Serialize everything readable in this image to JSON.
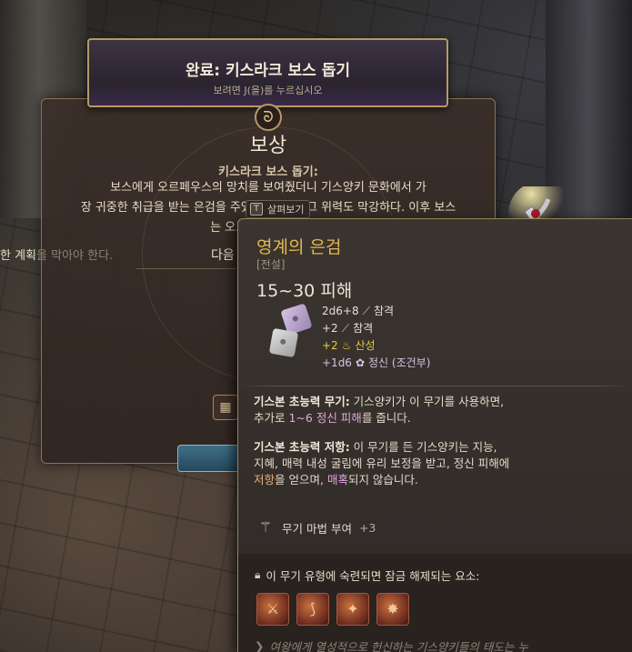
{
  "quest": {
    "banner_title": "완료: 키스라크 보스 돕기",
    "banner_subtitle": "보려면 J(을)를 누르십시오",
    "reward_title": "보상",
    "quest_name": "키스라크 보스 돕기:",
    "description_lines": [
      "보스에게 오르페우스의 망치를 보여줬더니 기스양키 문화에서 가",
      "장 귀중한 취급을 받는 은검을 주었다. 하지만 그 위력도 막강하다. 이후 보스",
      "는 오르페우스를 구출한"
    ],
    "description_cut": "한 계획",
    "description_faded": "을 막아야 한다.",
    "next_label": "다음"
  },
  "inspect_hint": {
    "key": "T",
    "label": "살펴보기"
  },
  "item": {
    "name": "영계의 은검",
    "rarity": "[전설]",
    "damage": "15~30 피해",
    "damage_lines": [
      {
        "text": "2d6+8",
        "type": "참격",
        "color": "white"
      },
      {
        "text": "+2",
        "type": "참격",
        "color": "white"
      },
      {
        "text": "+2",
        "type": "산성",
        "color": "yellow"
      },
      {
        "text": "+1d6",
        "type": "정신 (조건부)",
        "color": "lavender"
      }
    ],
    "passive1": {
      "title": "기스본 초능력 무기:",
      "text_a": " 기스양키가 이 무기를 사용하면, 추가로 ",
      "highlight": "1~6 정신 피해",
      "text_b": "를 줍니다."
    },
    "passive2": {
      "title": "기스본 초능력 저항:",
      "text_a": " 이 무기를 든 기스양키는 지능, 지혜, 매력 내성 굴림에 유리 보정을 받고, 정신 피해에 ",
      "highlight": "저항",
      "text_b": "을 얻으며, ",
      "highlight2": "매혹",
      "text_c": "되지 않습니다."
    },
    "enchant": {
      "label": "무기 마법 부여",
      "value": "+3"
    },
    "unlock_label": "이 무기 유형에 숙련되면 잠금 해제되는 요소:",
    "unlock_actions": [
      "slash-action-icon",
      "cleave-action-icon",
      "pommel-strike-icon",
      "flourish-icon"
    ],
    "flavor": "여왕에게 열성적으로 헌신하는 기스양키들의 태도는 누"
  },
  "colors": {
    "item_name": "#e3b84e",
    "acid": "#e4d03a",
    "psychic": "#d4c3e6",
    "highlight_pink": "#e2a6dc"
  }
}
